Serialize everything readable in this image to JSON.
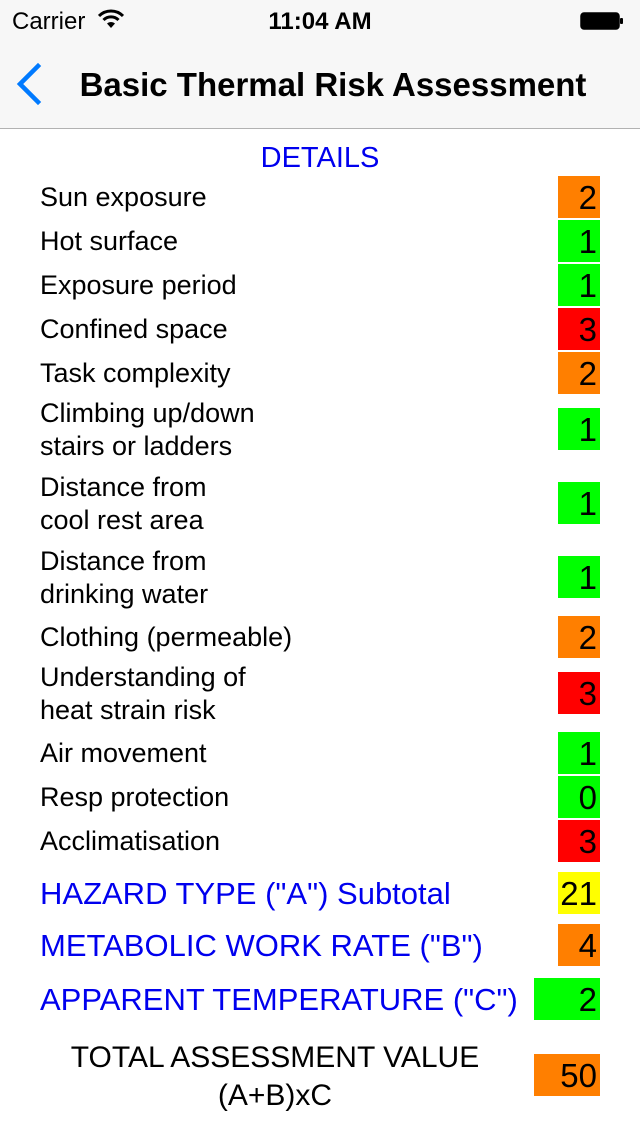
{
  "status_bar": {
    "carrier": "Carrier",
    "time": "11:04 AM"
  },
  "nav": {
    "title": "Basic Thermal Risk Assessment",
    "back_icon": "chevron-left-icon"
  },
  "colors": {
    "green": "#00ff00",
    "orange": "#ff7f00",
    "red": "#ff0000",
    "yellow": "#ffff00",
    "link_blue": "#0000ee",
    "ios_blue": "#007aff"
  },
  "details": {
    "header": "DETAILS",
    "items": [
      {
        "label": "Sun exposure",
        "value": "2",
        "level": "orange"
      },
      {
        "label": "Hot surface",
        "value": "1",
        "level": "green"
      },
      {
        "label": "Exposure period",
        "value": "1",
        "level": "green"
      },
      {
        "label": "Confined space",
        "value": "3",
        "level": "red"
      },
      {
        "label": "Task complexity",
        "value": "2",
        "level": "orange"
      },
      {
        "label_line1": "Climbing up/down",
        "label_line2": "stairs or ladders",
        "value": "1",
        "level": "green"
      },
      {
        "label_line1": "Distance from",
        "label_line2": "cool rest area",
        "value": "1",
        "level": "green"
      },
      {
        "label_line1": "Distance from",
        "label_line2": "drinking water",
        "value": "1",
        "level": "green"
      },
      {
        "label": "Clothing (permeable)",
        "value": "2",
        "level": "orange"
      },
      {
        "label_line1": "Understanding of",
        "label_line2": "heat strain risk",
        "value": "3",
        "level": "red"
      },
      {
        "label": "Air movement",
        "value": "1",
        "level": "green"
      },
      {
        "label": "Resp protection",
        "value": "0",
        "level": "green"
      },
      {
        "label": "Acclimatisation",
        "value": "3",
        "level": "red"
      }
    ]
  },
  "summary": {
    "hazard": {
      "label": "HAZARD TYPE (\"A\") Subtotal",
      "value": "21",
      "level": "yellow"
    },
    "metabolic": {
      "label": "METABOLIC WORK RATE (\"B\")",
      "value": "4",
      "level": "orange"
    },
    "apparent": {
      "label": "APPARENT TEMPERATURE (\"C\")",
      "value": "2",
      "level": "green"
    },
    "total": {
      "label_line1": "TOTAL ASSESSMENT VALUE",
      "label_line2": "(A+B)xC",
      "value": "50",
      "level": "orange"
    }
  }
}
